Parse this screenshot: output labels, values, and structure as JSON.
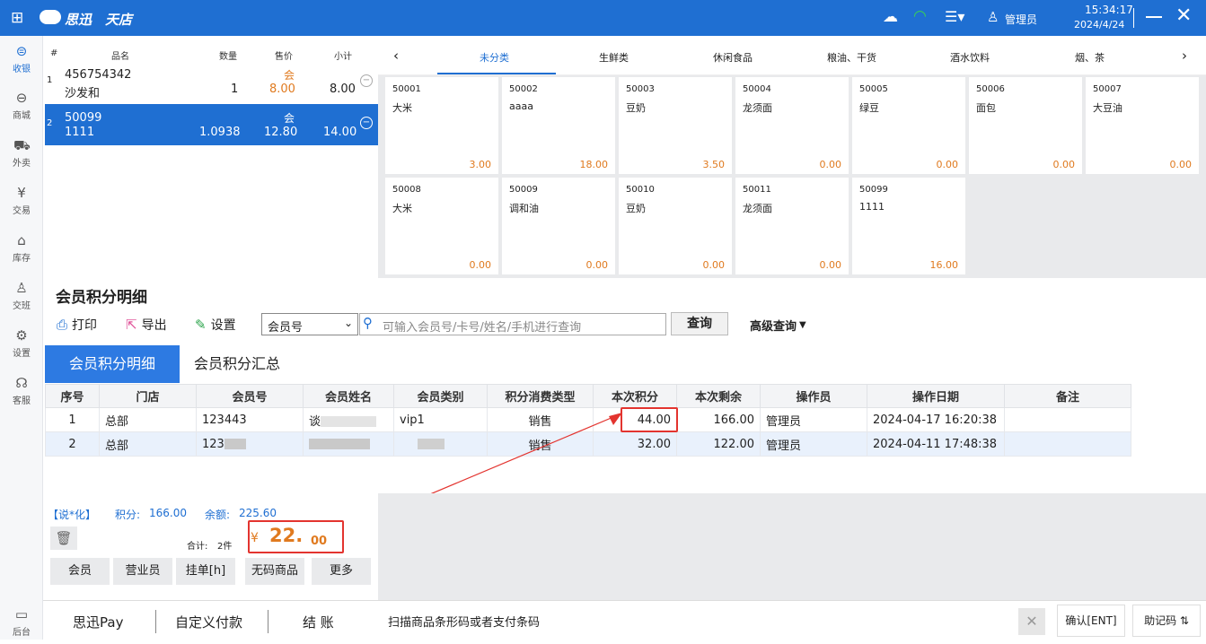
{
  "app": {
    "brand": "思迅",
    "product": "天店",
    "time": "15:34:17",
    "date": "2024/4/24",
    "user": "管理员"
  },
  "sidebar": [
    {
      "label": "收银",
      "icon": "cashier-icon",
      "active": true
    },
    {
      "label": "商城",
      "icon": "mall-icon"
    },
    {
      "label": "外卖",
      "icon": "delivery-icon"
    },
    {
      "label": "交易",
      "icon": "yen-icon"
    },
    {
      "label": "库存",
      "icon": "warehouse-icon"
    },
    {
      "label": "交班",
      "icon": "handover-icon"
    },
    {
      "label": "设置",
      "icon": "gear-icon"
    },
    {
      "label": "客服",
      "icon": "headset-icon"
    },
    {
      "label": "后台",
      "icon": "monitor-icon"
    }
  ],
  "cart": {
    "headers": {
      "idx": "#",
      "name": "品名",
      "qty": "数量",
      "price": "售价",
      "subtotal": "小计"
    },
    "rows": [
      {
        "idx": "1",
        "code": "456754342",
        "name": "沙发和",
        "qty": "1",
        "tag": "会",
        "price": "8.00",
        "subtotal": "8.00"
      },
      {
        "idx": "2",
        "code": "50099",
        "name": "1111",
        "qty": "1.0938",
        "tag": "会",
        "price": "12.80",
        "subtotal": "14.00"
      }
    ]
  },
  "categories": [
    "未分类",
    "生鲜类",
    "休闲食品",
    "粮油、干货",
    "酒水饮料",
    "烟、茶"
  ],
  "products": [
    {
      "code": "50001",
      "name": "大米",
      "price": "3.00"
    },
    {
      "code": "50002",
      "name": "aaaa",
      "price": "18.00"
    },
    {
      "code": "50003",
      "name": "豆奶",
      "price": "3.50"
    },
    {
      "code": "50004",
      "name": "龙须面",
      "price": "0.00"
    },
    {
      "code": "50005",
      "name": "绿豆",
      "price": "0.00"
    },
    {
      "code": "50006",
      "name": "面包",
      "price": "0.00"
    },
    {
      "code": "50007",
      "name": "大豆油",
      "price": "0.00"
    },
    {
      "code": "50008",
      "name": "大米",
      "price": "0.00"
    },
    {
      "code": "50009",
      "name": "调和油",
      "price": "0.00"
    },
    {
      "code": "50010",
      "name": "豆奶",
      "price": "0.00"
    },
    {
      "code": "50011",
      "name": "龙须面",
      "price": "0.00"
    },
    {
      "code": "50099",
      "name": "1111",
      "price": "16.00"
    }
  ],
  "points_panel": {
    "title": "会员积分明细",
    "toolbar": {
      "print": "打印",
      "export": "导出",
      "settings": "设置",
      "search_type": "会员号",
      "search_placeholder": "可输入会员号/卡号/姓名/手机进行查询",
      "query": "查询",
      "advanced": "高级查询"
    },
    "tabs": [
      "会员积分明细",
      "会员积分汇总"
    ],
    "columns": [
      "序号",
      "门店",
      "会员号",
      "会员姓名",
      "会员类别",
      "积分消费类型",
      "本次积分",
      "本次剩余",
      "操作员",
      "操作日期",
      "备注"
    ],
    "rows": [
      {
        "no": "1",
        "store": "总部",
        "member_no": "123443",
        "member_name": "谈",
        "category": "vip1",
        "type": "销售",
        "points": "44.00",
        "remaining": "166.00",
        "operator": "管理员",
        "date": "2024-04-17 16:20:38",
        "note": ""
      },
      {
        "no": "2",
        "store": "总部",
        "member_no": "123",
        "member_name": "",
        "category": "",
        "type": "销售",
        "points": "32.00",
        "remaining": "122.00",
        "operator": "管理员",
        "date": "2024-04-11 17:48:38",
        "note": ""
      }
    ]
  },
  "member_summary": {
    "name": "【说*化】",
    "points_label": "积分:",
    "points": "166.00",
    "balance_label": "余额:",
    "balance": "225.60",
    "total_label": "合计:",
    "total_count": "2件",
    "currency": "¥",
    "amount_int": "22.",
    "amount_dec": "00"
  },
  "footer_buttons": [
    "会员",
    "营业员",
    "挂单[h]",
    "无码商品",
    "更多"
  ],
  "bottom": {
    "pay1": "思迅Pay",
    "pay2": "自定义付款",
    "checkout": "结 账",
    "scan_placeholder": "扫描商品条形码或者支付条码",
    "confirm": "确认[ENT]",
    "helper": "助记码 ⇅"
  }
}
